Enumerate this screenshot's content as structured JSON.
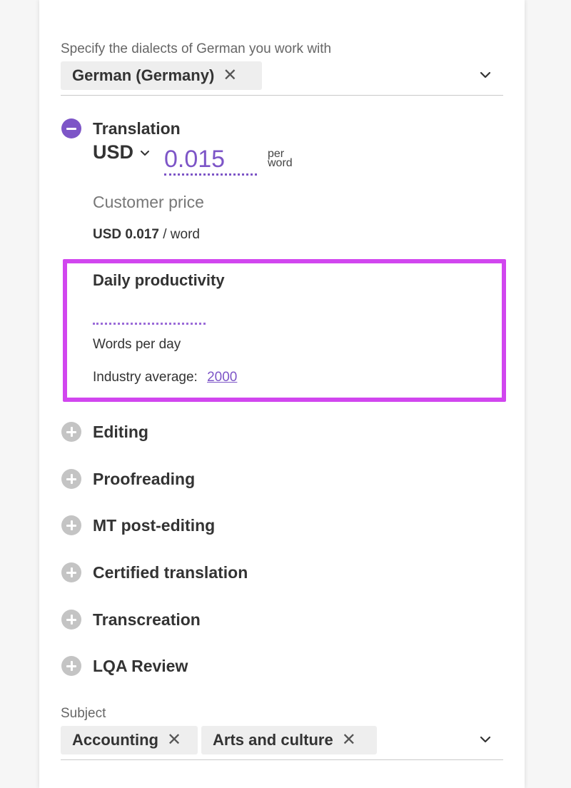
{
  "dialects": {
    "label": "Specify the dialects of German you work with",
    "chips": [
      "German (Germany)"
    ]
  },
  "translation": {
    "title": "Translation",
    "currency": "USD",
    "price": "0.015",
    "per": "per",
    "word_unit": "word",
    "customer_price_label": "Customer price",
    "customer_price_value": "USD 0.017",
    "customer_price_unit": " / word"
  },
  "productivity": {
    "title": "Daily productivity",
    "value": "",
    "words_per_day": "Words per day",
    "industry_label": "Industry average:",
    "industry_value": "2000"
  },
  "services": [
    "Editing",
    "Proofreading",
    "MT post-editing",
    "Certified translation",
    "Transcreation",
    "LQA Review"
  ],
  "subject": {
    "label": "Subject",
    "chips": [
      "Accounting",
      "Arts and culture"
    ]
  },
  "colors": {
    "accent": "#7d55c7",
    "highlight": "#d146ef",
    "inactive_icon": "#c4c4c4"
  }
}
